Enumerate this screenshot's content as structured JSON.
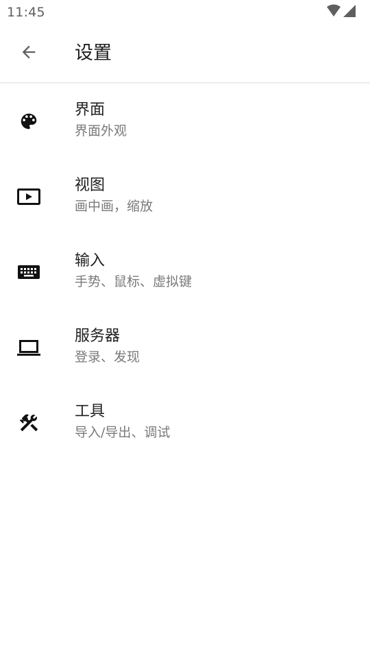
{
  "status_bar": {
    "time": "11:45",
    "icons": [
      "wifi-icon",
      "cellular-signal-icon"
    ]
  },
  "app_bar": {
    "back_icon": "arrow-back-icon",
    "title": "设置"
  },
  "settings": {
    "items": [
      {
        "key": "interface",
        "icon": "palette-icon",
        "title": "界面",
        "subtitle": "界面外观"
      },
      {
        "key": "view",
        "icon": "video-display-icon",
        "title": "视图",
        "subtitle": "画中画，缩放"
      },
      {
        "key": "input",
        "icon": "keyboard-icon",
        "title": "输入",
        "subtitle": "手势、鼠标、虚拟键"
      },
      {
        "key": "server",
        "icon": "laptop-icon",
        "title": "服务器",
        "subtitle": "登录、发现"
      },
      {
        "key": "tools",
        "icon": "tools-icon",
        "title": "工具",
        "subtitle": "导入/导出、调试"
      }
    ]
  },
  "colors": {
    "icon": "#111111",
    "title_text": "#1f1f1f",
    "subtitle_text": "#7a7a7a",
    "status_text": "#5f5f5f"
  }
}
